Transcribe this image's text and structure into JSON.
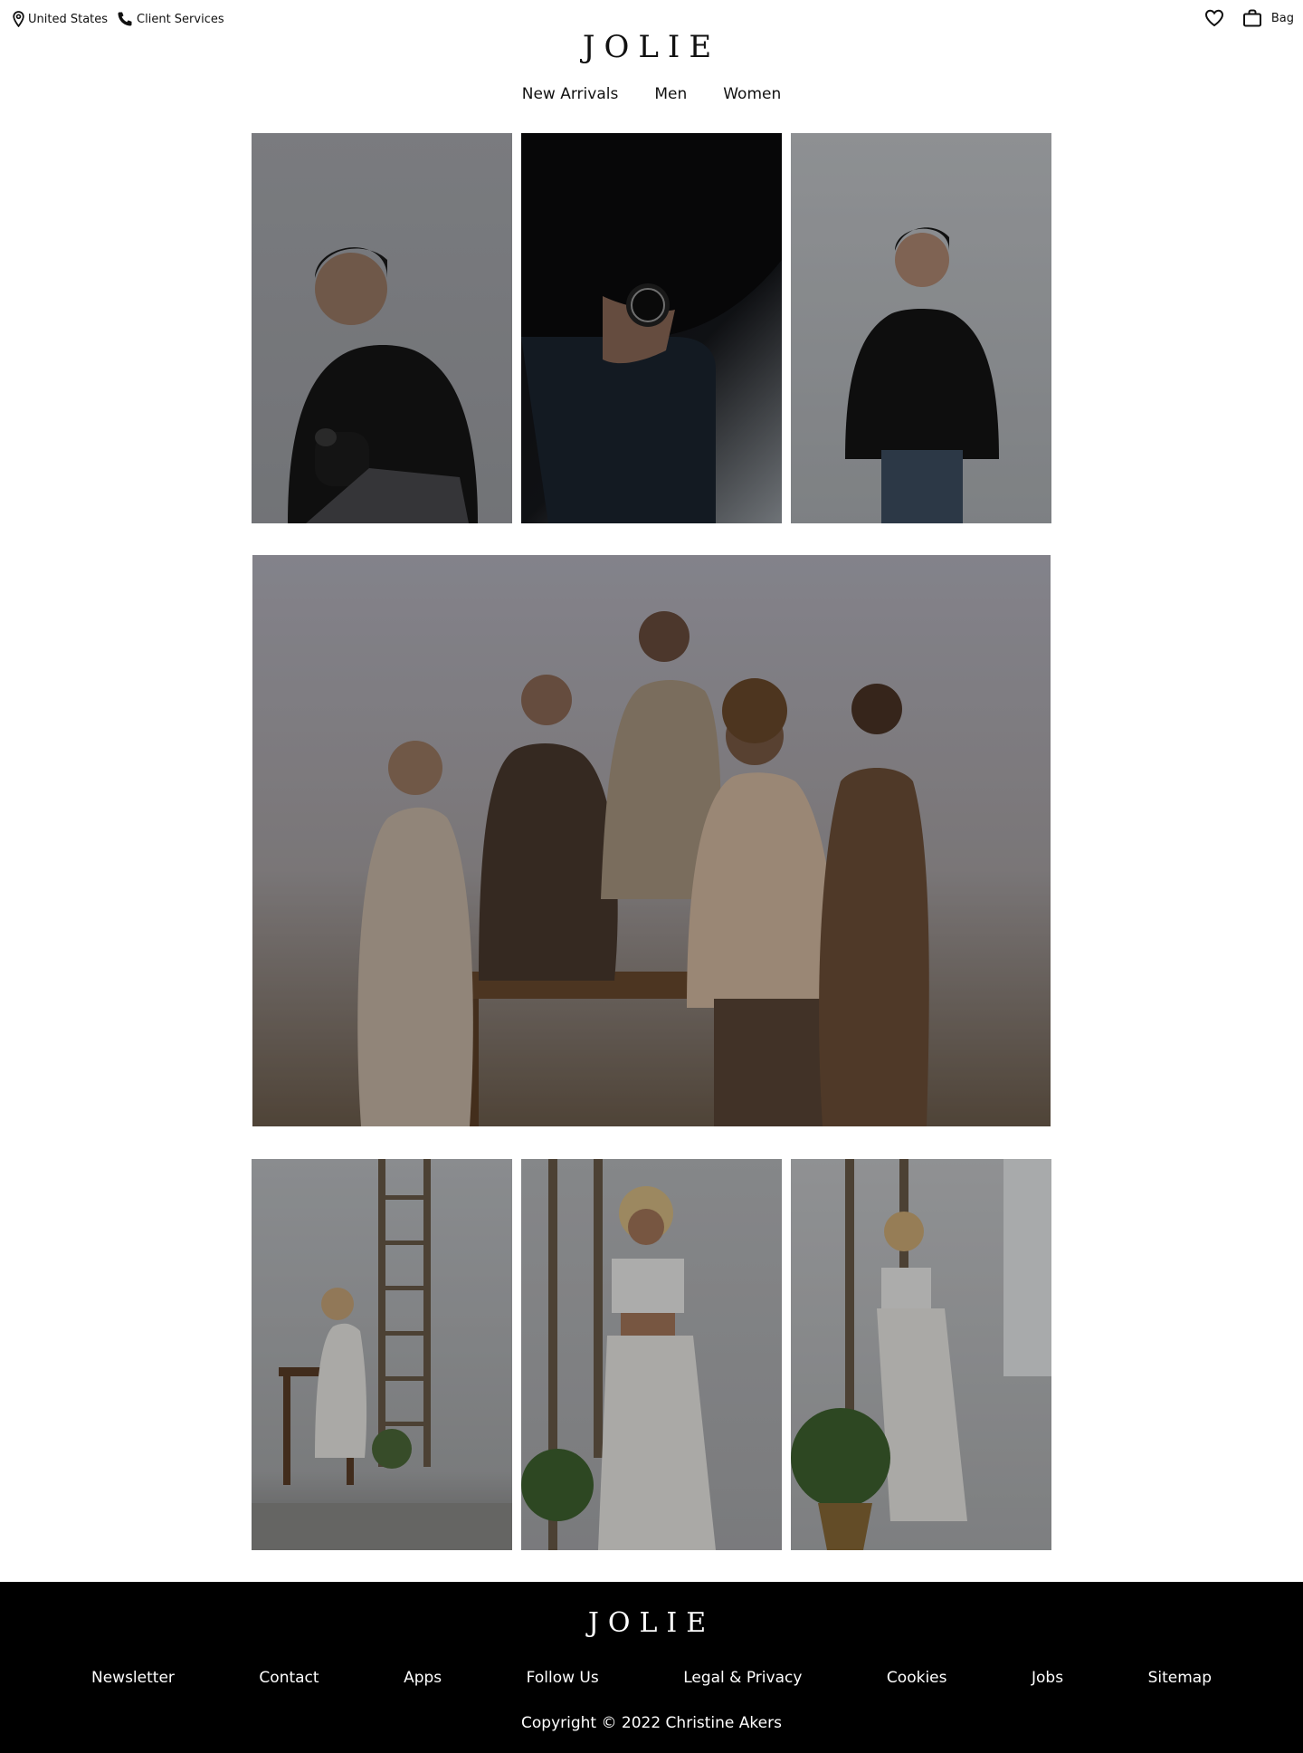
{
  "topbar": {
    "location": "United States",
    "services": "Client Services",
    "bag": "Bag"
  },
  "brand": {
    "name": "JOLIE"
  },
  "nav": {
    "items": [
      "New Arrivals",
      "Men",
      "Women"
    ]
  },
  "footer": {
    "brand": "JOLIE",
    "links": [
      "Newsletter",
      "Contact",
      "Apps",
      "Follow Us",
      "Legal & Privacy",
      "Cookies",
      "Jobs",
      "Sitemap"
    ],
    "copyright": "Copyright © 2022 Christine Akers"
  },
  "icons": {
    "location": "map-pin-icon",
    "phone": "phone-icon",
    "wishlist": "heart-icon",
    "bag": "shopping-bag-icon"
  },
  "colors": {
    "background": "#ffffff",
    "footer_bg": "#000000",
    "text": "#111111"
  }
}
